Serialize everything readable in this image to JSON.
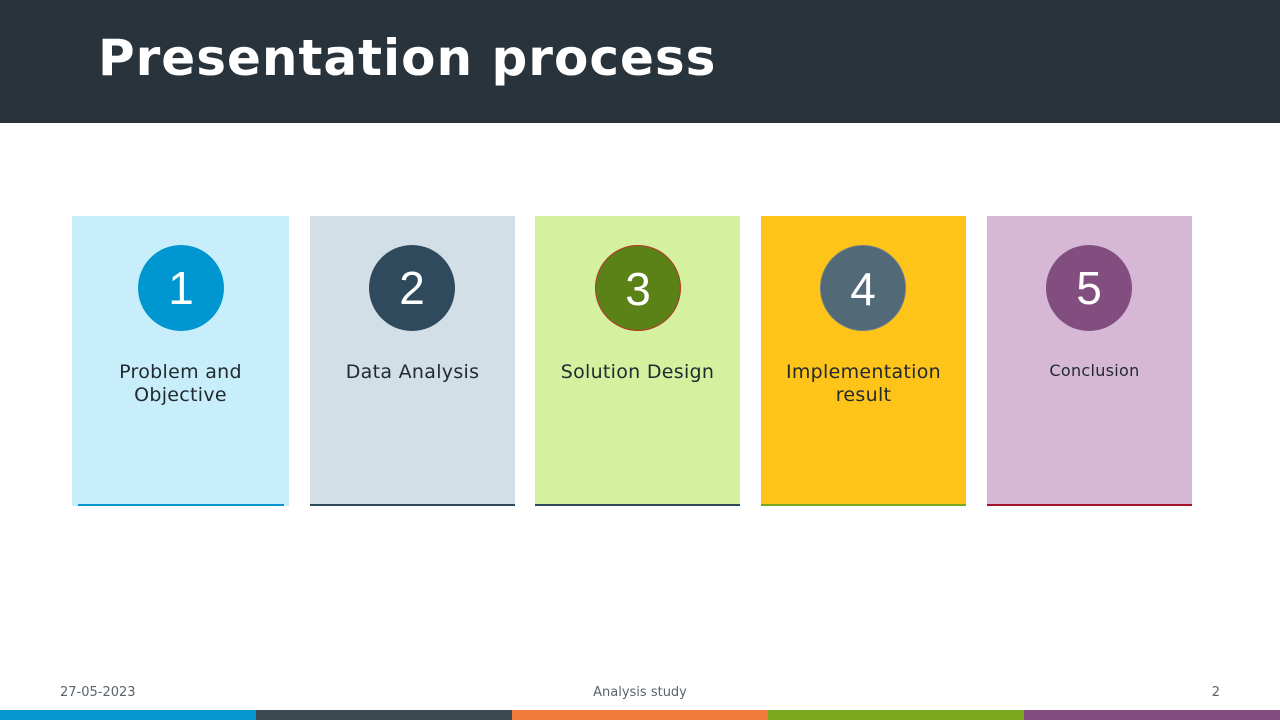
{
  "slide": {
    "title": "Presentation process"
  },
  "steps": [
    {
      "number": "1",
      "label": "Problem and Objective",
      "color": "#0096cf"
    },
    {
      "number": "2",
      "label": "Data Analysis",
      "color": "#304a5d"
    },
    {
      "number": "3",
      "label": "Solution Design",
      "color": "#5b8216"
    },
    {
      "number": "4",
      "label": "Implementation result",
      "color": "#526977"
    },
    {
      "number": "5",
      "label": "Conclusion",
      "color": "#824e80"
    }
  ],
  "footer": {
    "date": "27-05-2023",
    "center_text": "Analysis study",
    "page_number": "2"
  },
  "theme": {
    "header_bg": "#29333b",
    "accent_bar": [
      "#0896cf",
      "#3d4a52",
      "#ef7a3a",
      "#7aa81e",
      "#824e80"
    ]
  }
}
